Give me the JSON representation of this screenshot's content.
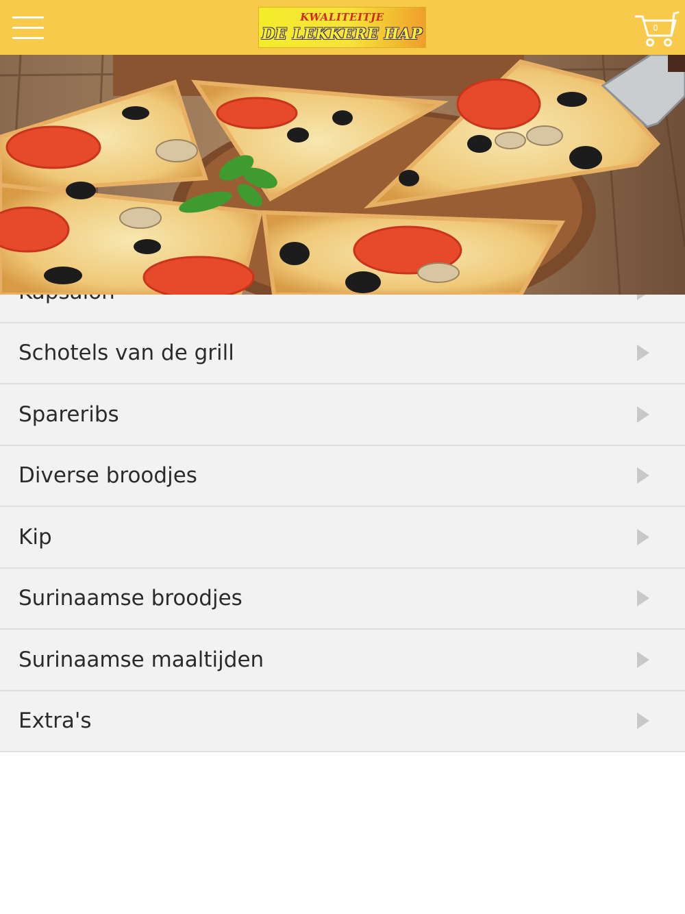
{
  "header": {
    "menu_icon": "hamburger-menu-icon",
    "logo": {
      "line1": "KWALITEITJE",
      "line2": "DE LEKKERE HAP"
    },
    "cart": {
      "icon": "shopping-cart-icon",
      "count": "0"
    },
    "colors": {
      "bar": "#f8c94b"
    }
  },
  "hero": {
    "image": "pizza-photo"
  },
  "menu": {
    "items": [
      {
        "label": "Kapsalon"
      },
      {
        "label": "Schotels van de grill"
      },
      {
        "label": "Spareribs"
      },
      {
        "label": "Diverse broodjes"
      },
      {
        "label": "Kip"
      },
      {
        "label": "Surinaamse broodjes"
      },
      {
        "label": "Surinaamse maaltijden"
      },
      {
        "label": "Extra's"
      }
    ],
    "arrow_icon": "chevron-right-icon"
  }
}
